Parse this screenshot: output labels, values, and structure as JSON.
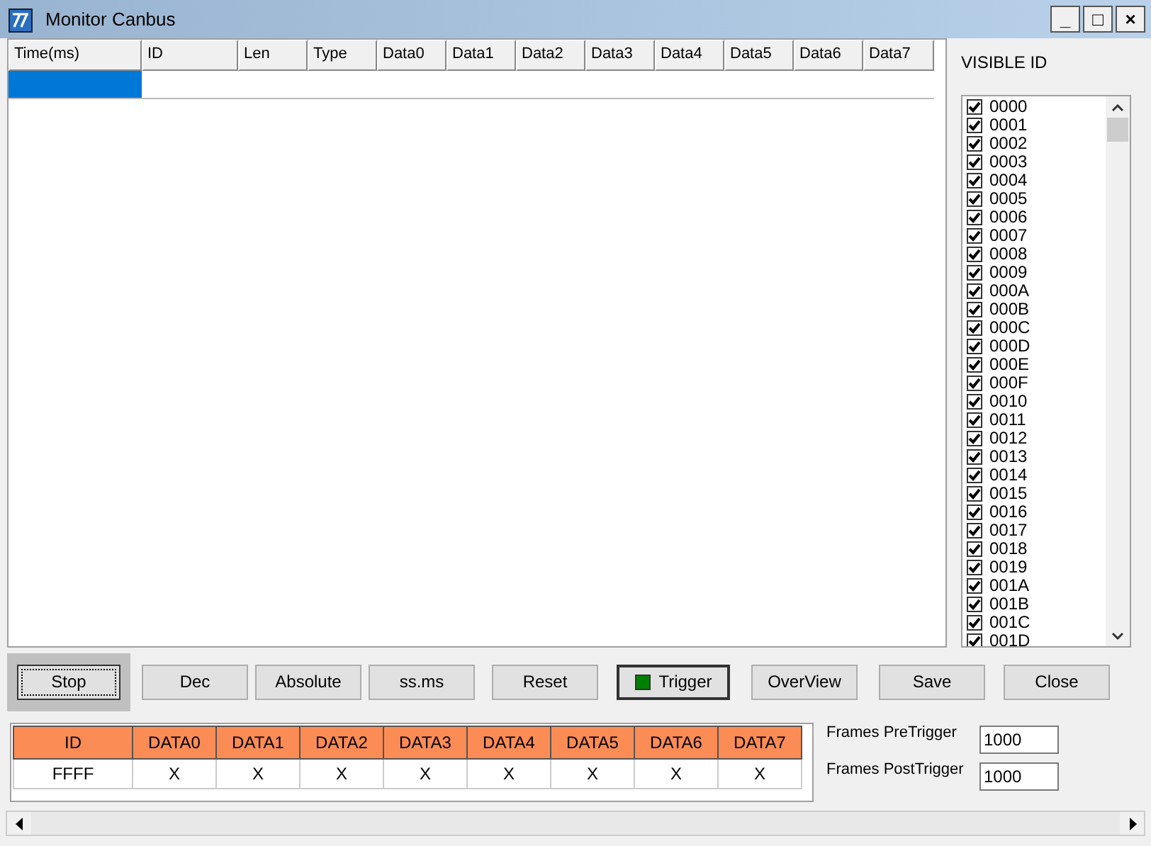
{
  "window": {
    "title": "Monitor Canbus",
    "controls": [
      "_",
      "□",
      "×"
    ]
  },
  "grid": {
    "columns": [
      "Time(ms)",
      "ID",
      "Len",
      "Type",
      "Data0",
      "Data1",
      "Data2",
      "Data3",
      "Data4",
      "Data5",
      "Data6",
      "Data7"
    ],
    "rows": [
      {
        "selected": true
      }
    ]
  },
  "visible_id": {
    "title": "VISIBLE ID",
    "items": [
      {
        "label": "0000",
        "checked": true
      },
      {
        "label": "0001",
        "checked": true
      },
      {
        "label": "0002",
        "checked": true
      },
      {
        "label": "0003",
        "checked": true
      },
      {
        "label": "0004",
        "checked": true
      },
      {
        "label": "0005",
        "checked": true
      },
      {
        "label": "0006",
        "checked": true
      },
      {
        "label": "0007",
        "checked": true
      },
      {
        "label": "0008",
        "checked": true
      },
      {
        "label": "0009",
        "checked": true
      },
      {
        "label": "000A",
        "checked": true
      },
      {
        "label": "000B",
        "checked": true
      },
      {
        "label": "000C",
        "checked": true
      },
      {
        "label": "000D",
        "checked": true
      },
      {
        "label": "000E",
        "checked": true
      },
      {
        "label": "000F",
        "checked": true
      },
      {
        "label": "0010",
        "checked": true
      },
      {
        "label": "0011",
        "checked": true
      },
      {
        "label": "0012",
        "checked": true
      },
      {
        "label": "0013",
        "checked": true
      },
      {
        "label": "0014",
        "checked": true
      },
      {
        "label": "0015",
        "checked": true
      },
      {
        "label": "0016",
        "checked": true
      },
      {
        "label": "0017",
        "checked": true
      },
      {
        "label": "0018",
        "checked": true
      },
      {
        "label": "0019",
        "checked": true
      },
      {
        "label": "001A",
        "checked": true
      },
      {
        "label": "001B",
        "checked": true
      },
      {
        "label": "001C",
        "checked": true
      },
      {
        "label": "001D",
        "checked": true
      }
    ]
  },
  "buttons": [
    {
      "label": "Stop",
      "kind": "plain",
      "focused": true
    },
    {
      "label": "Dec",
      "kind": "plain",
      "focused": false
    },
    {
      "label": "Absolute",
      "kind": "plain",
      "focused": false
    },
    {
      "label": "ss.ms",
      "kind": "plain",
      "focused": false
    },
    {
      "label": "Reset",
      "kind": "plain",
      "focused": false
    },
    {
      "label": "Trigger",
      "kind": "indicator",
      "focused": false
    },
    {
      "label": "OverView",
      "kind": "plain",
      "focused": false
    },
    {
      "label": "Save",
      "kind": "plain",
      "focused": false
    },
    {
      "label": "Close",
      "kind": "plain",
      "focused": false
    }
  ],
  "trigger_table": {
    "columns": [
      "ID",
      "DATA0",
      "DATA1",
      "DATA2",
      "DATA3",
      "DATA4",
      "DATA5",
      "DATA6",
      "DATA7"
    ],
    "rows": [
      [
        "FFFF",
        "X",
        "X",
        "X",
        "X",
        "X",
        "X",
        "X",
        "X"
      ]
    ]
  },
  "frame_fields": [
    {
      "label": "Frames PreTrigger",
      "value": "1000"
    },
    {
      "label": "Frames PostTrigger",
      "value": "1000"
    }
  ]
}
